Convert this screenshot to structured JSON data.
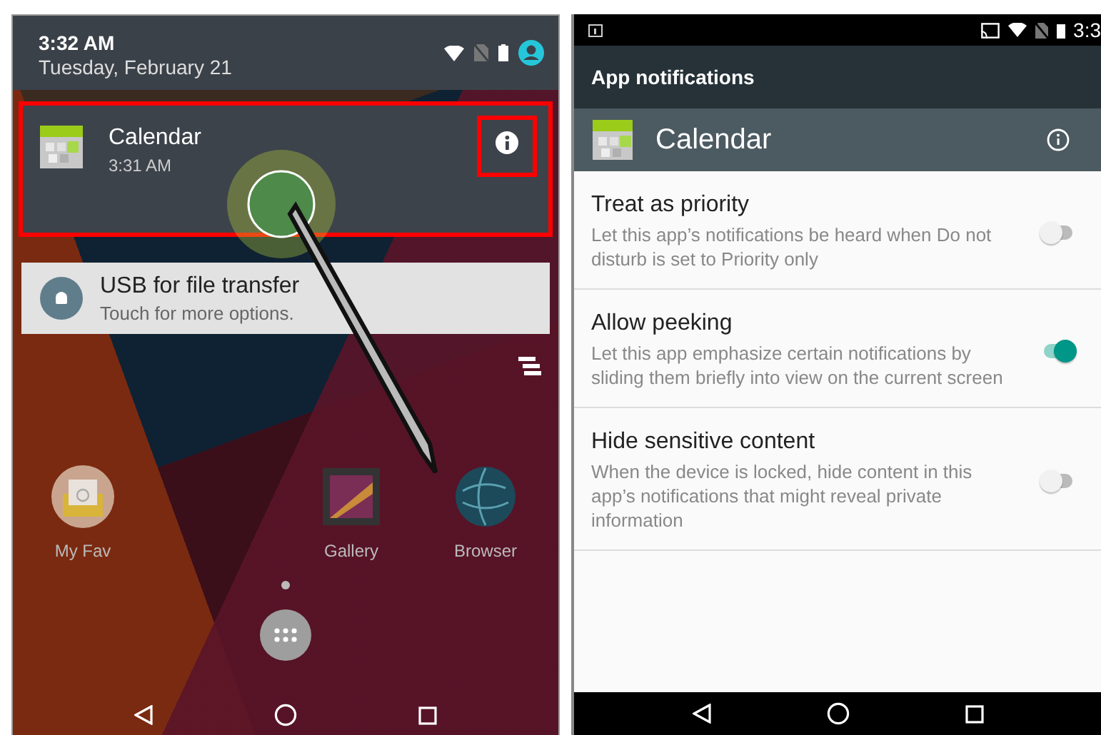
{
  "left_screen": {
    "header": {
      "time": "3:32 AM",
      "date": "Tuesday, February 21"
    },
    "notifications": [
      {
        "kind": "app",
        "title": "Calendar",
        "time": "3:31 AM",
        "highlighted": true,
        "info_highlighted": true
      },
      {
        "kind": "system",
        "title": "USB for file transfer",
        "text": "Touch for more options.",
        "highlighted": false
      }
    ],
    "home_apps": [
      {
        "kind": "mail",
        "label": "My Fav"
      },
      {
        "kind": "gallery",
        "label": "Gallery"
      },
      {
        "kind": "globe",
        "label": "Browser"
      }
    ]
  },
  "right_screen": {
    "status_time": "3:3",
    "title": "App notifications",
    "app_name": "Calendar",
    "settings": [
      {
        "title": "Treat as priority",
        "description": "Let this app’s notifications be heard when Do not disturb is set to Priority only",
        "on": false
      },
      {
        "title": "Allow peeking",
        "description": "Let this app emphasize certain notifications by sliding them briefly into view on the current screen",
        "on": true
      },
      {
        "title": "Hide sensitive content",
        "description": "When the device is locked, hide content in this app’s notifications that might reveal private information",
        "on": false
      }
    ]
  }
}
